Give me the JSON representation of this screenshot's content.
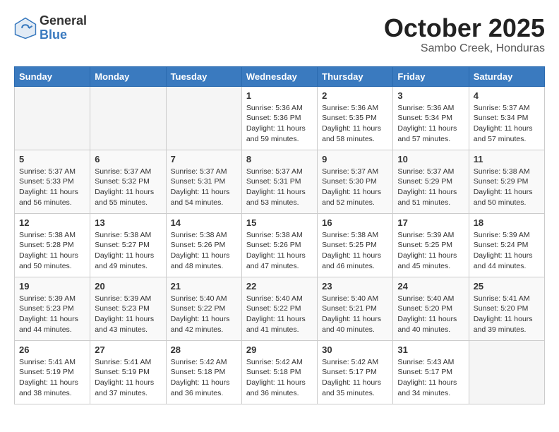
{
  "logo": {
    "general": "General",
    "blue": "Blue"
  },
  "title": "October 2025",
  "subtitle": "Sambo Creek, Honduras",
  "days_of_week": [
    "Sunday",
    "Monday",
    "Tuesday",
    "Wednesday",
    "Thursday",
    "Friday",
    "Saturday"
  ],
  "weeks": [
    [
      {
        "day": "",
        "info": ""
      },
      {
        "day": "",
        "info": ""
      },
      {
        "day": "",
        "info": ""
      },
      {
        "day": "1",
        "info": "Sunrise: 5:36 AM\nSunset: 5:36 PM\nDaylight: 11 hours\nand 59 minutes."
      },
      {
        "day": "2",
        "info": "Sunrise: 5:36 AM\nSunset: 5:35 PM\nDaylight: 11 hours\nand 58 minutes."
      },
      {
        "day": "3",
        "info": "Sunrise: 5:36 AM\nSunset: 5:34 PM\nDaylight: 11 hours\nand 57 minutes."
      },
      {
        "day": "4",
        "info": "Sunrise: 5:37 AM\nSunset: 5:34 PM\nDaylight: 11 hours\nand 57 minutes."
      }
    ],
    [
      {
        "day": "5",
        "info": "Sunrise: 5:37 AM\nSunset: 5:33 PM\nDaylight: 11 hours\nand 56 minutes."
      },
      {
        "day": "6",
        "info": "Sunrise: 5:37 AM\nSunset: 5:32 PM\nDaylight: 11 hours\nand 55 minutes."
      },
      {
        "day": "7",
        "info": "Sunrise: 5:37 AM\nSunset: 5:31 PM\nDaylight: 11 hours\nand 54 minutes."
      },
      {
        "day": "8",
        "info": "Sunrise: 5:37 AM\nSunset: 5:31 PM\nDaylight: 11 hours\nand 53 minutes."
      },
      {
        "day": "9",
        "info": "Sunrise: 5:37 AM\nSunset: 5:30 PM\nDaylight: 11 hours\nand 52 minutes."
      },
      {
        "day": "10",
        "info": "Sunrise: 5:37 AM\nSunset: 5:29 PM\nDaylight: 11 hours\nand 51 minutes."
      },
      {
        "day": "11",
        "info": "Sunrise: 5:38 AM\nSunset: 5:29 PM\nDaylight: 11 hours\nand 50 minutes."
      }
    ],
    [
      {
        "day": "12",
        "info": "Sunrise: 5:38 AM\nSunset: 5:28 PM\nDaylight: 11 hours\nand 50 minutes."
      },
      {
        "day": "13",
        "info": "Sunrise: 5:38 AM\nSunset: 5:27 PM\nDaylight: 11 hours\nand 49 minutes."
      },
      {
        "day": "14",
        "info": "Sunrise: 5:38 AM\nSunset: 5:26 PM\nDaylight: 11 hours\nand 48 minutes."
      },
      {
        "day": "15",
        "info": "Sunrise: 5:38 AM\nSunset: 5:26 PM\nDaylight: 11 hours\nand 47 minutes."
      },
      {
        "day": "16",
        "info": "Sunrise: 5:38 AM\nSunset: 5:25 PM\nDaylight: 11 hours\nand 46 minutes."
      },
      {
        "day": "17",
        "info": "Sunrise: 5:39 AM\nSunset: 5:25 PM\nDaylight: 11 hours\nand 45 minutes."
      },
      {
        "day": "18",
        "info": "Sunrise: 5:39 AM\nSunset: 5:24 PM\nDaylight: 11 hours\nand 44 minutes."
      }
    ],
    [
      {
        "day": "19",
        "info": "Sunrise: 5:39 AM\nSunset: 5:23 PM\nDaylight: 11 hours\nand 44 minutes."
      },
      {
        "day": "20",
        "info": "Sunrise: 5:39 AM\nSunset: 5:23 PM\nDaylight: 11 hours\nand 43 minutes."
      },
      {
        "day": "21",
        "info": "Sunrise: 5:40 AM\nSunset: 5:22 PM\nDaylight: 11 hours\nand 42 minutes."
      },
      {
        "day": "22",
        "info": "Sunrise: 5:40 AM\nSunset: 5:22 PM\nDaylight: 11 hours\nand 41 minutes."
      },
      {
        "day": "23",
        "info": "Sunrise: 5:40 AM\nSunset: 5:21 PM\nDaylight: 11 hours\nand 40 minutes."
      },
      {
        "day": "24",
        "info": "Sunrise: 5:40 AM\nSunset: 5:20 PM\nDaylight: 11 hours\nand 40 minutes."
      },
      {
        "day": "25",
        "info": "Sunrise: 5:41 AM\nSunset: 5:20 PM\nDaylight: 11 hours\nand 39 minutes."
      }
    ],
    [
      {
        "day": "26",
        "info": "Sunrise: 5:41 AM\nSunset: 5:19 PM\nDaylight: 11 hours\nand 38 minutes."
      },
      {
        "day": "27",
        "info": "Sunrise: 5:41 AM\nSunset: 5:19 PM\nDaylight: 11 hours\nand 37 minutes."
      },
      {
        "day": "28",
        "info": "Sunrise: 5:42 AM\nSunset: 5:18 PM\nDaylight: 11 hours\nand 36 minutes."
      },
      {
        "day": "29",
        "info": "Sunrise: 5:42 AM\nSunset: 5:18 PM\nDaylight: 11 hours\nand 36 minutes."
      },
      {
        "day": "30",
        "info": "Sunrise: 5:42 AM\nSunset: 5:17 PM\nDaylight: 11 hours\nand 35 minutes."
      },
      {
        "day": "31",
        "info": "Sunrise: 5:43 AM\nSunset: 5:17 PM\nDaylight: 11 hours\nand 34 minutes."
      },
      {
        "day": "",
        "info": ""
      }
    ]
  ]
}
